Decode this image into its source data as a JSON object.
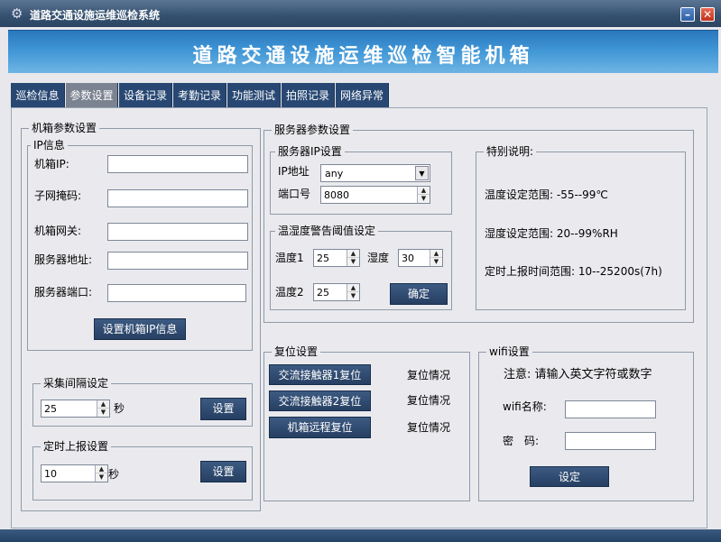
{
  "window": {
    "title": "道路交通设施运维巡检系统",
    "minimize": "–",
    "close": "✕"
  },
  "banner": {
    "title": "道路交通设施运维巡检智能机箱"
  },
  "tabs": [
    "巡检信息",
    "参数设置",
    "设备记录",
    "考勤记录",
    "功能测试",
    "拍照记录",
    "网络异常"
  ],
  "box_params": {
    "legend": "机箱参数设置",
    "ip_info": {
      "legend": "IP信息",
      "box_ip_label": "机箱IP:",
      "subnet_label": "子网掩码:",
      "gateway_label": "机箱网关:",
      "server_addr_label": "服务器地址:",
      "server_port_label": "服务器端口:",
      "box_ip": "",
      "subnet": "",
      "gateway": "",
      "server_addr": "",
      "server_port": "",
      "set_button": "设置机箱IP信息"
    },
    "collect": {
      "legend": "采集间隔设定",
      "value": "25",
      "unit": "秒",
      "button": "设置"
    },
    "report": {
      "legend": "定时上报设置",
      "value": "10",
      "unit": "秒",
      "button": "设置"
    }
  },
  "server_params": {
    "legend": "服务器参数设置",
    "ip": {
      "legend": "服务器IP设置",
      "addr_label": "IP地址",
      "addr_value": "any",
      "port_label": "端口号",
      "port_value": "8080"
    },
    "thresholds": {
      "legend": "温湿度警告阈值设定",
      "temp1_label": "温度1",
      "temp1": "25",
      "hum_label": "湿度",
      "hum": "30",
      "temp2_label": "温度2",
      "temp2": "25",
      "confirm": "确定"
    },
    "notes": {
      "legend": "特别说明:",
      "temp_range": "温度设定范围: -55--99℃",
      "hum_range": "湿度设定范围: 20--99%RH",
      "report_range": "定时上报时间范围: 10--25200s(7h)"
    }
  },
  "reset": {
    "legend": "复位设置",
    "items": [
      {
        "button": "交流接触器1复位",
        "status": "复位情况"
      },
      {
        "button": "交流接触器2复位",
        "status": "复位情况"
      },
      {
        "button": "机箱远程复位",
        "status": "复位情况"
      }
    ]
  },
  "wifi": {
    "legend": "wifi设置",
    "notice": "注意: 请输入英文字符或数字",
    "name_label": "wifi名称:",
    "pwd_label": "密　码:",
    "name": "",
    "pwd": "",
    "button": "设定"
  }
}
